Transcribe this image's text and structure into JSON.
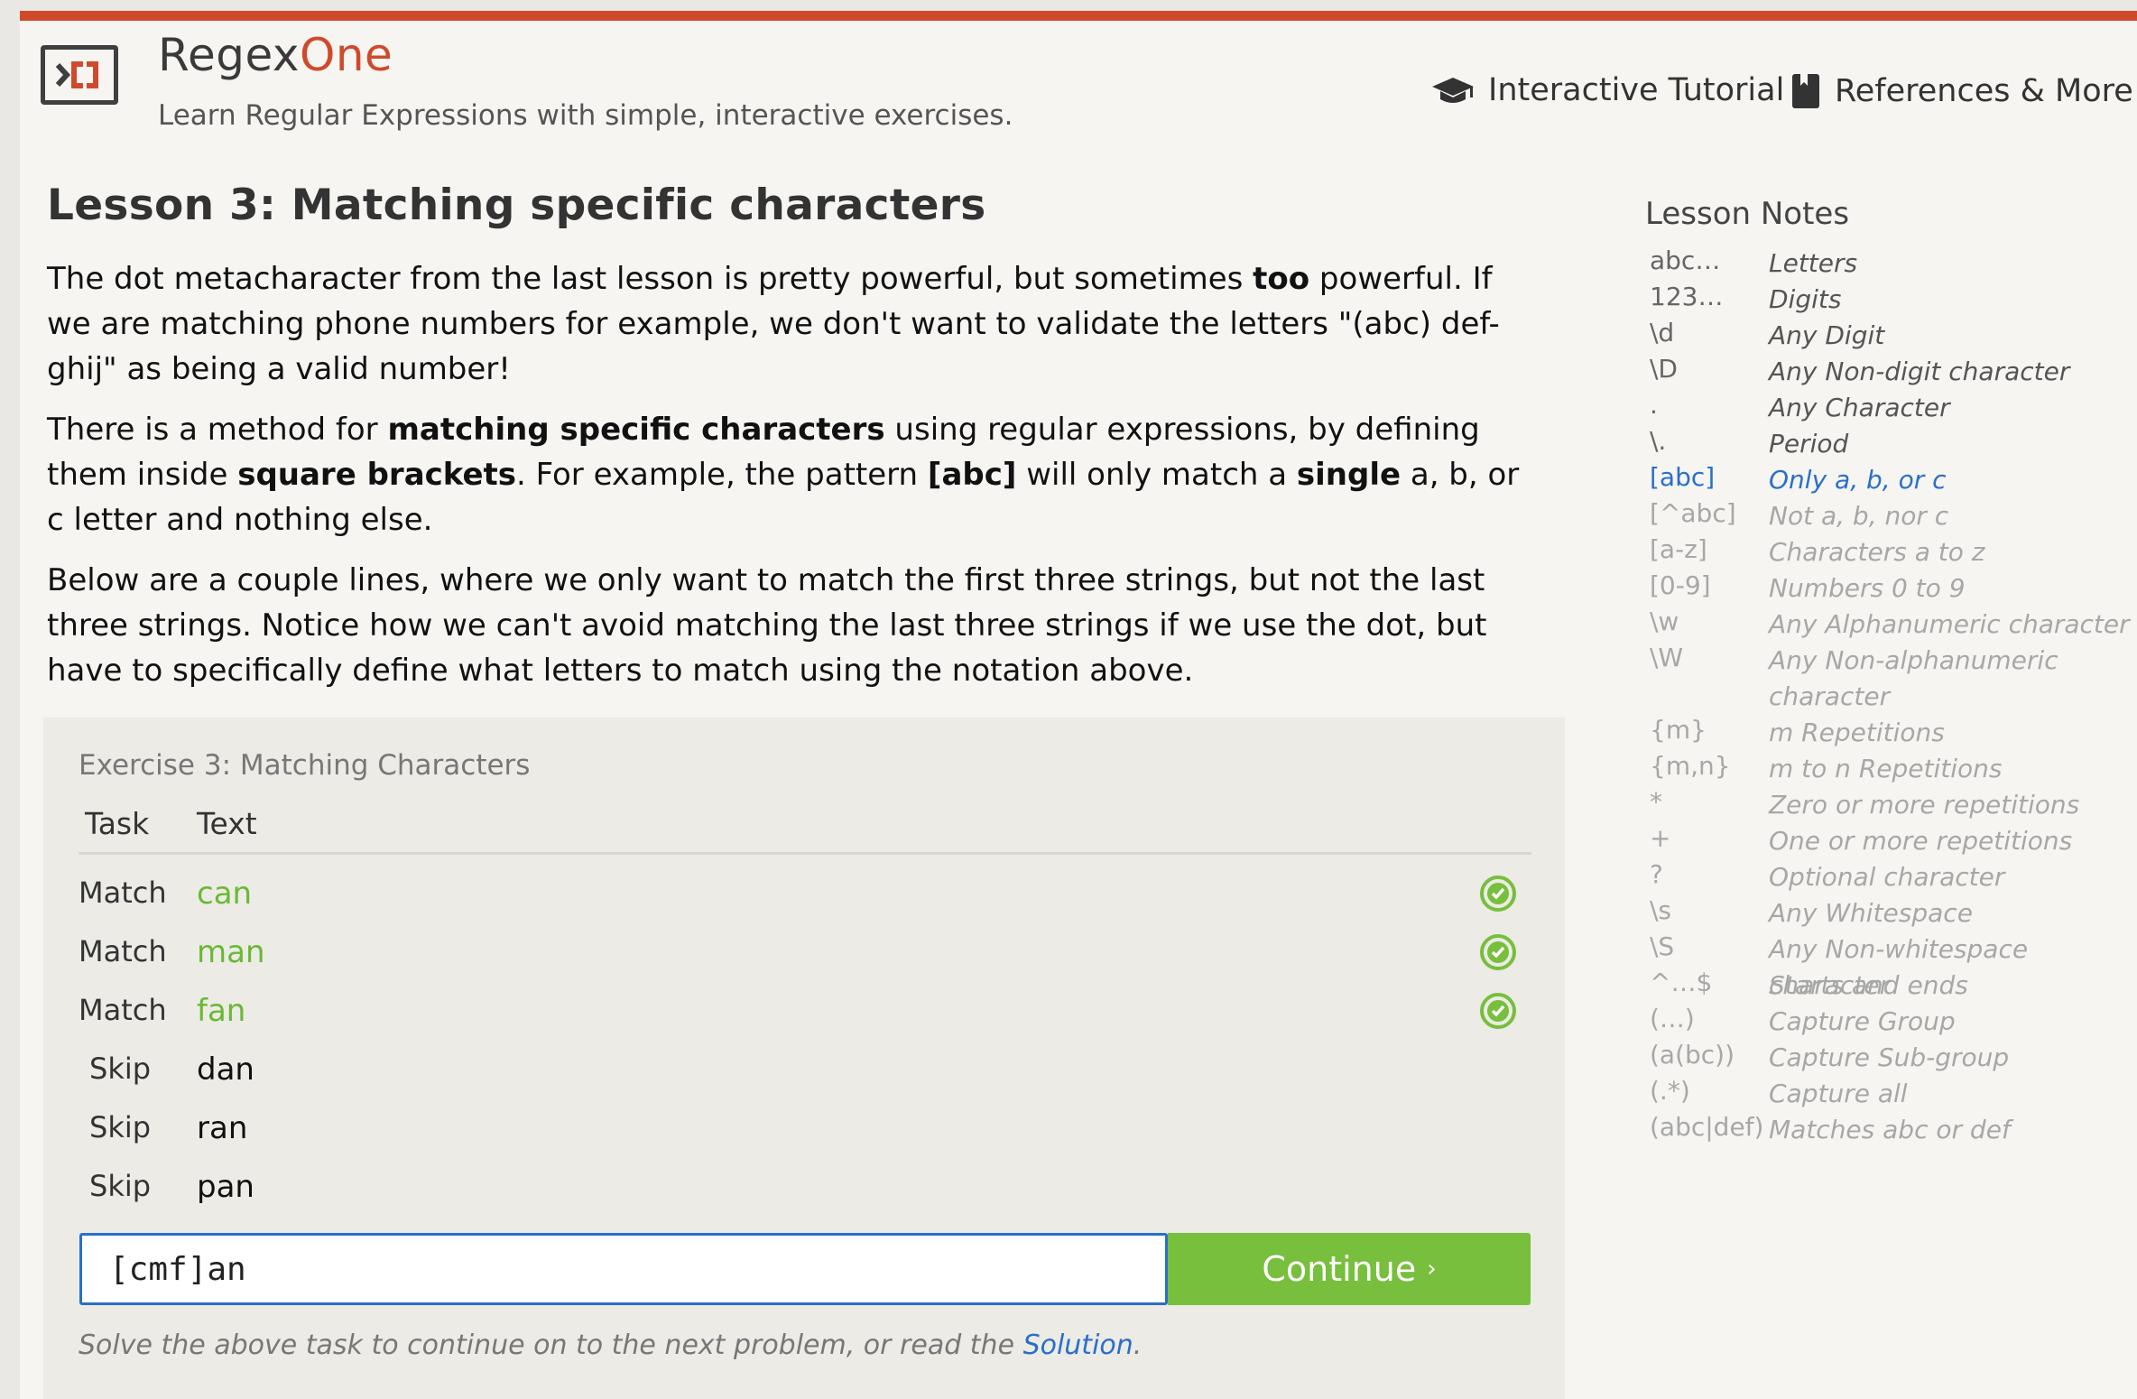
{
  "header": {
    "brand_part1": "Regex",
    "brand_part2": "One",
    "tagline": "Learn Regular Expressions with simple, interactive exercises.",
    "nav": [
      {
        "label": "Interactive Tutorial",
        "icon": "graduation-cap-icon"
      },
      {
        "label": "References & More",
        "icon": "book-icon"
      }
    ]
  },
  "lesson": {
    "title": "Lesson 3: Matching specific characters",
    "p1": {
      "a": "The dot metacharacter from the last lesson is pretty powerful, but sometimes ",
      "b": "too",
      "c": " powerful. If we are matching phone numbers for example, we don't want to validate the letters \"(abc) def-ghij\" as being a valid number!"
    },
    "p2": {
      "a": "There is a method for ",
      "b": "matching specific characters",
      "c": " using regular expressions, by defining them inside ",
      "d": "square brackets",
      "e": ". For example, the pattern ",
      "f": "[abc]",
      "g": " will only match a ",
      "h": "single",
      "i": " a, b, or c letter and nothing else."
    },
    "p3": "Below are a couple lines, where we only want to match the first three strings, but not the last three strings. Notice how we can't avoid matching the last three strings if we use the dot, but have to specifically define what letters to match using the notation above."
  },
  "exercise": {
    "title": "Exercise 3: Matching Characters",
    "col_task": "Task",
    "col_text": "Text",
    "rows": [
      {
        "task": "Match",
        "text": "can",
        "status": "success"
      },
      {
        "task": "Match",
        "text": "man",
        "status": "success"
      },
      {
        "task": "Match",
        "text": "fan",
        "status": "success"
      },
      {
        "task": "Skip",
        "text": "dan",
        "status": "none"
      },
      {
        "task": "Skip",
        "text": "ran",
        "status": "none"
      },
      {
        "task": "Skip",
        "text": "pan",
        "status": "none"
      }
    ],
    "input_value": "[cmf]an",
    "continue_label": "Continue",
    "continue_arrow": "›",
    "hint_prefix": "Solve the above task to continue on to the next problem, or read the ",
    "hint_link": "Solution",
    "hint_suffix": "."
  },
  "notes": {
    "title": "Lesson Notes",
    "items": [
      {
        "key": "abc…",
        "value": "Letters"
      },
      {
        "key": "123…",
        "value": "Digits"
      },
      {
        "key": "\\d",
        "value": "Any Digit"
      },
      {
        "key": "\\D",
        "value": "Any Non-digit character"
      },
      {
        "key": ".",
        "value": "Any Character"
      },
      {
        "key": "\\.",
        "value": "Period"
      },
      {
        "key": "[abc]",
        "value": "Only a, b, or c"
      },
      {
        "key": "[^abc]",
        "value": "Not a, b, nor c"
      },
      {
        "key": "[a-z]",
        "value": "Characters a to z"
      },
      {
        "key": "[0-9]",
        "value": "Numbers 0 to 9"
      },
      {
        "key": "\\w",
        "value": "Any Alphanumeric character"
      },
      {
        "key": "\\W",
        "value": "Any Non-alphanumeric character"
      },
      {
        "key": "{m}",
        "value": "m Repetitions"
      },
      {
        "key": "{m,n}",
        "value": "m to n Repetitions"
      },
      {
        "key": "*",
        "value": "Zero or more repetitions"
      },
      {
        "key": "+",
        "value": "One or more repetitions"
      },
      {
        "key": "?",
        "value": "Optional character"
      },
      {
        "key": "\\s",
        "value": "Any Whitespace"
      },
      {
        "key": "\\S",
        "value": "Any Non-whitespace character"
      },
      {
        "key": "^…$",
        "value": "Starts and ends"
      },
      {
        "key": "(…)",
        "value": "Capture Group"
      },
      {
        "key": "(a(bc))",
        "value": "Capture Sub-group"
      },
      {
        "key": "(.*)",
        "value": "Capture all"
      },
      {
        "key": "(abc|def)",
        "value": "Matches abc or def"
      }
    ]
  },
  "colors": {
    "accent": "#cf4a2b",
    "success": "#77bf3c",
    "link": "#2a6fc9"
  }
}
